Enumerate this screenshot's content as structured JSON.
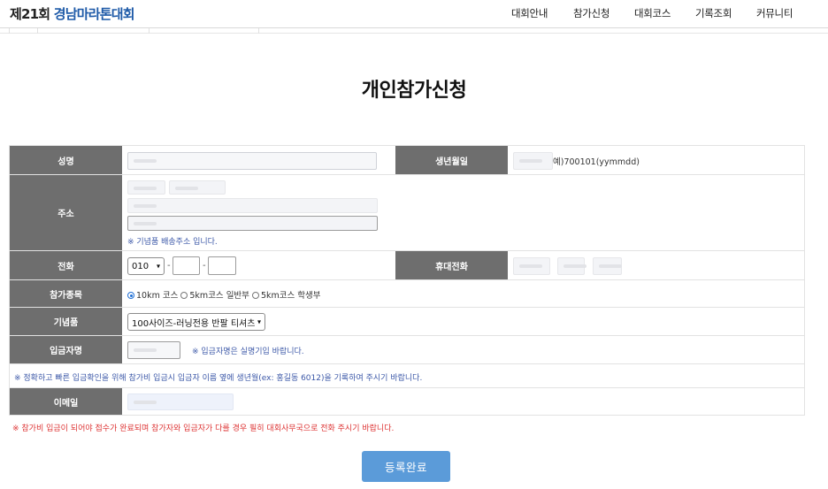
{
  "header": {
    "logo_prefix": "제21회",
    "logo_main": "경남마라톤대회",
    "nav": [
      "대회안내",
      "참가신청",
      "대회코스",
      "기록조회",
      "커뮤니티"
    ]
  },
  "page_title": "개인참가신청",
  "form": {
    "name": {
      "label": "성명"
    },
    "birth": {
      "label": "생년월일",
      "hint": "예)700101(yymmdd)"
    },
    "address": {
      "label": "주소",
      "note": "※ 기념품 배송주소 입니다."
    },
    "phone": {
      "label": "전화",
      "prefix": "010",
      "sep": "-"
    },
    "mobile": {
      "label": "휴대전화"
    },
    "event": {
      "label": "참가종목",
      "options": [
        "10km 코스",
        "5km코스 일반부",
        "5km코스 학생부"
      ],
      "selected": "10km 코스"
    },
    "souvenir": {
      "label": "기념품",
      "selected": "100사이즈-러닝전용 반팔 티셔츠"
    },
    "depositor": {
      "label": "입금자명",
      "note": "※ 입금자명은 실명기입 바랍니다."
    },
    "notice": "※ 정확하고 빠른 입금확인을 위해 참가비 입금시 입금자 이름 옆에 생년월(ex: 홍길동 6012)을 기록하여 주시기 바랍니다.",
    "email": {
      "label": "이메일"
    }
  },
  "footnote": "※ 참가비 입금이 되어야 접수가 완료되며 참가자와 입금자가 다를 경우 필히 대회사무국으로 전화 주시기 바랍니다.",
  "submit_label": "등록완료",
  "colors": {
    "header_cell": "#6e6e6e",
    "logo_blue": "#1e5aa8",
    "submit": "#5b9bd9",
    "note_blue": "#3c58a8",
    "note_red": "#dd3333"
  }
}
